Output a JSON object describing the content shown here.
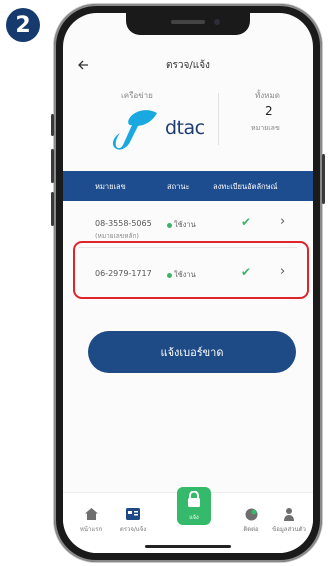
{
  "step_badge": "2",
  "header": {
    "title": "ตรวจ/แจ้ง"
  },
  "info": {
    "network_label": "เครือข่าย",
    "operator": "dtac",
    "total_label": "ทั้งหมด",
    "total_value": "2",
    "total_unit": "หมายเลข"
  },
  "table": {
    "headers": [
      "หมายเลข",
      "สถานะ",
      "ลงทะเบียนอัตลักษณ์"
    ],
    "rows": [
      {
        "number": "08-3558-5065",
        "note": "(หมายเลขหลัก)",
        "status": "ใช้งาน",
        "check": "✔",
        "chevron": "›"
      },
      {
        "number": "06-2979-1717",
        "note": "",
        "status": "ใช้งาน",
        "check": "✔",
        "chevron": "›"
      }
    ]
  },
  "report_button": "แจ้งเบอร์ขาด",
  "nav": {
    "home": "หน้าแรก",
    "check": "ตรวจ/แจ้ง",
    "center": "แจ้ง",
    "contact": "ติดต่อ",
    "profile": "ข้อมูลส่วนตัว"
  },
  "colors": {
    "brand_blue": "#1e4a86",
    "accent_green": "#35b96a",
    "highlight_red": "#e0242c",
    "dtac_blue": "#19a8e0"
  }
}
